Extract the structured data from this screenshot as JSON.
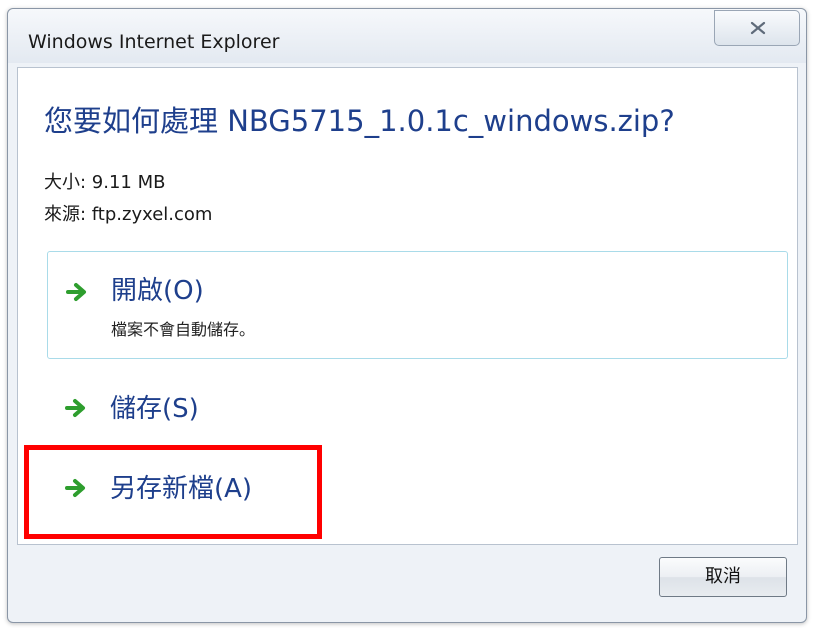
{
  "window": {
    "title": "Windows Internet Explorer",
    "close_label": "✕"
  },
  "dialog": {
    "heading": "您要如何處理 NBG5715_1.0.1c_windows.zip?",
    "size_text": "大小: 9.11 MB",
    "source_text": "來源: ftp.zyxel.com"
  },
  "options": [
    {
      "label": "開啟(O)",
      "description": "檔案不會自動儲存。",
      "icon": "green-arrow-icon"
    },
    {
      "label": "儲存(S)",
      "icon": "green-arrow-icon"
    },
    {
      "label": "另存新檔(A)",
      "icon": "green-arrow-icon"
    }
  ],
  "buttons": {
    "cancel_label": "取消"
  },
  "colors": {
    "heading": "#1e3f8c",
    "arrow": "#2e9e2e",
    "highlight": "#ff0000",
    "option_border": "#a9dbe9"
  }
}
